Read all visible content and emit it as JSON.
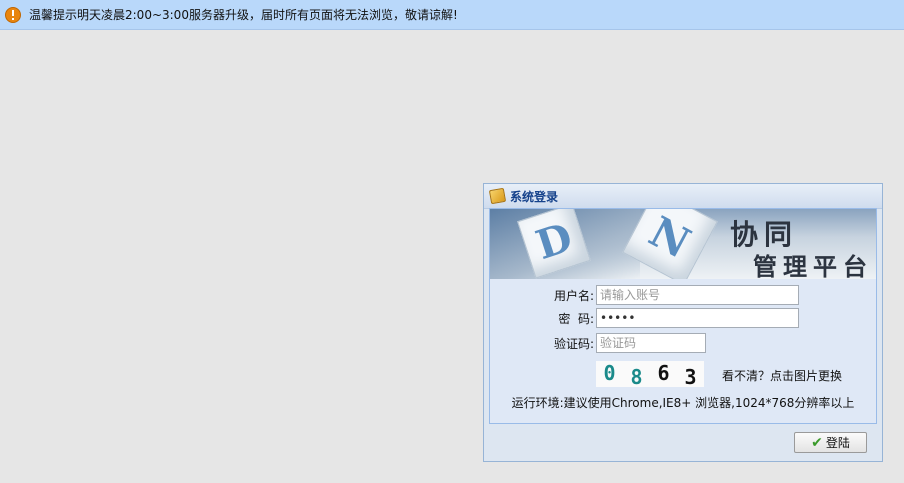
{
  "notice": {
    "icon": "warning-icon",
    "text": "温馨提示明天凌晨2:00~3:00服务器升级，届时所有页面将无法浏览，敬请谅解!"
  },
  "panel": {
    "title": "系统登录",
    "banner": {
      "letter1": "D",
      "letter2": "N",
      "line1": "协同",
      "line2": "管理平台"
    },
    "username": {
      "label": "用户名:",
      "placeholder": "请输入账号",
      "value": ""
    },
    "password": {
      "label": "密  码:",
      "value": "*****"
    },
    "captcha": {
      "label": "验证码:",
      "placeholder": "验证码",
      "digits": [
        {
          "char": "0",
          "color": "#1a8a8a"
        },
        {
          "char": "8",
          "color": "#1a8a8a"
        },
        {
          "char": "6",
          "color": "#111111"
        },
        {
          "char": "3",
          "color": "#111111"
        }
      ],
      "refresh_text": "看不清？点击图片更换"
    },
    "environment": "运行环境:建议使用Chrome,IE8+ 浏览器,1024*768分辨率以上",
    "login_button": "登陆"
  }
}
